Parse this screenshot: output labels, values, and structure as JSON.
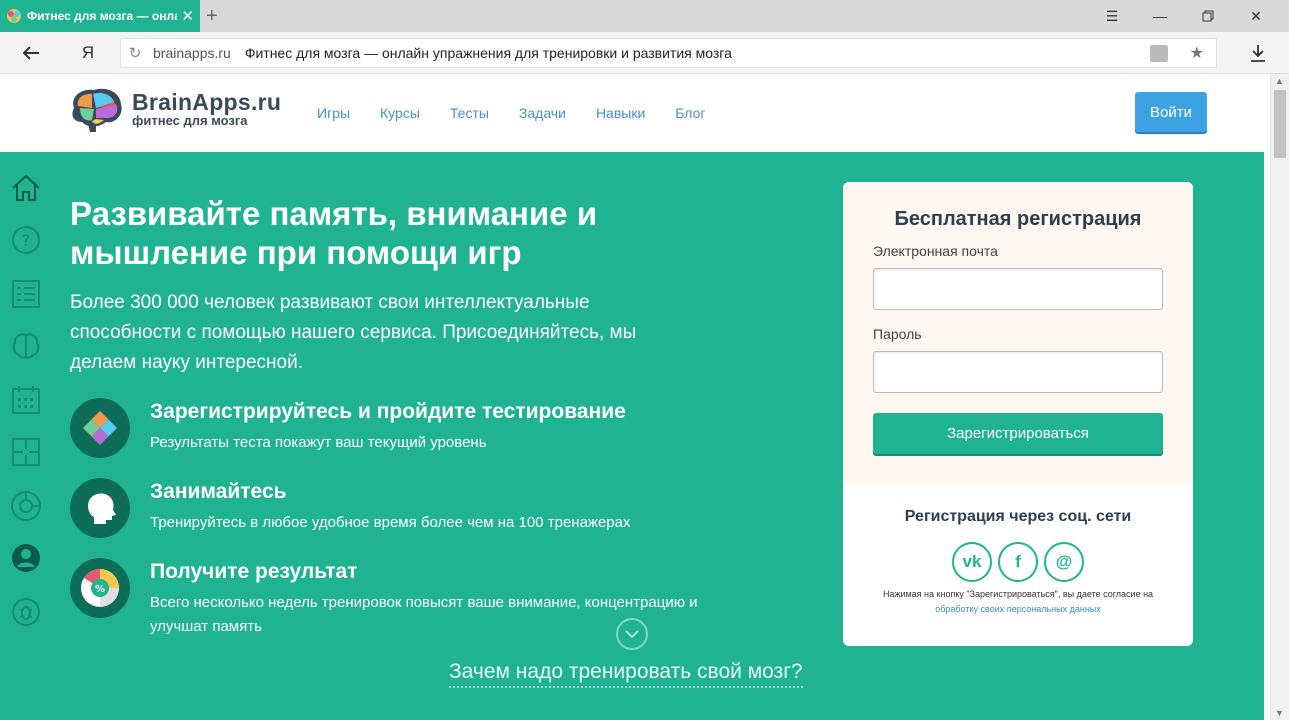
{
  "browser": {
    "tab_title": "Фитнес для мозга — онлайн упражнения",
    "tab_close_icon": "close-icon",
    "new_tab_symbol": "+",
    "url_domain": "brainapps.ru",
    "url_page_title": "Фитнес для мозга — онлайн упражнения для тренировки и развития мозга",
    "yandex_button": "Я",
    "accent_color": "#1fb391"
  },
  "header": {
    "logo_name": "BrainApps.ru",
    "logo_tagline": "фитнес для мозга",
    "menu": [
      {
        "label": "Игры"
      },
      {
        "label": "Курсы"
      },
      {
        "label": "Тесты"
      },
      {
        "label": "Задачи"
      },
      {
        "label": "Навыки"
      },
      {
        "label": "Блог"
      }
    ],
    "login_label": "Войти"
  },
  "sidebar": {
    "icons": [
      "home-icon",
      "question-icon",
      "checklist-icon",
      "brain-icon",
      "calendar-icon",
      "puzzle-icon",
      "target-icon",
      "profile-icon",
      "bug-icon"
    ]
  },
  "hero": {
    "title": "Развивайте память, внимание и мышление при помощи игр",
    "description": "Более 300 000 человек развивают свои интеллектуальные способности с помощью нашего сервиса. Присоединяйтесь, мы делаем науку интересной.",
    "features": [
      {
        "title": "Зарегистрируйтесь и пройдите тестирование",
        "desc": "Результаты теста покажут ваш текущий уровень",
        "icon": "puzzle-icon"
      },
      {
        "title": "Занимайтесь",
        "desc": "Тренируйтесь в любое удобное время более чем на 100 тренажерах",
        "icon": "head-icon"
      },
      {
        "title": "Получите результат",
        "desc": "Всего несколько недель тренировок повысят ваше внимание, концентрацию и улучшат память",
        "icon": "percent-chart-icon"
      }
    ],
    "why_link": "Зачем надо тренировать свой мозг?"
  },
  "registration": {
    "title": "Бесплатная регистрация",
    "email_label": "Электронная почта",
    "email_value": "",
    "password_label": "Пароль",
    "password_value": "",
    "submit_label": "Зарегистрироваться",
    "social_title": "Регистрация через соц. сети",
    "social": [
      {
        "label": "vk",
        "icon": "vk-icon"
      },
      {
        "label": "f",
        "icon": "facebook-icon"
      },
      {
        "label": "@",
        "icon": "mail-icon"
      }
    ],
    "consent_text": "Нажимая на кнопку \"Зарегистрироваться\", вы даете согласие на",
    "consent_link": "обработку своих персональных данных"
  }
}
